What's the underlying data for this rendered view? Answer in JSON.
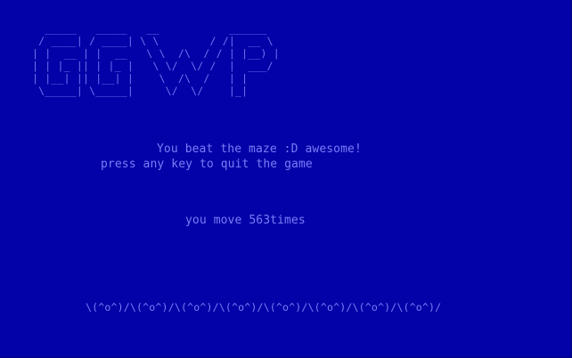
{
  "logo": {
    "ascii_art": "  _____   _____   __           ______ \n / ____| / ____| \\ \\        / /|  __ \\\n| |  __ | |  __   \\ \\  /\\  / / | |__) |\n| | |_ || | |_ |   \\ \\/  \\/ /  |  ___/\n| |__| || |__| |    \\  /\\  /   | |    \n \\_____| \\_____|     \\/  \\/    |_|    "
  },
  "messages": {
    "win": "You beat the maze :D awesome!",
    "quit": "press any key to quit the game",
    "moves": "you move 563times"
  },
  "decoration": {
    "banner": "\\(^o^)/\\(^o^)/\\(^o^)/\\(^o^)/\\(^o^)/\\(^o^)/\\(^o^)/\\(^o^)/"
  },
  "colors": {
    "background": "#0202a8",
    "text": "#7a7ef6"
  }
}
